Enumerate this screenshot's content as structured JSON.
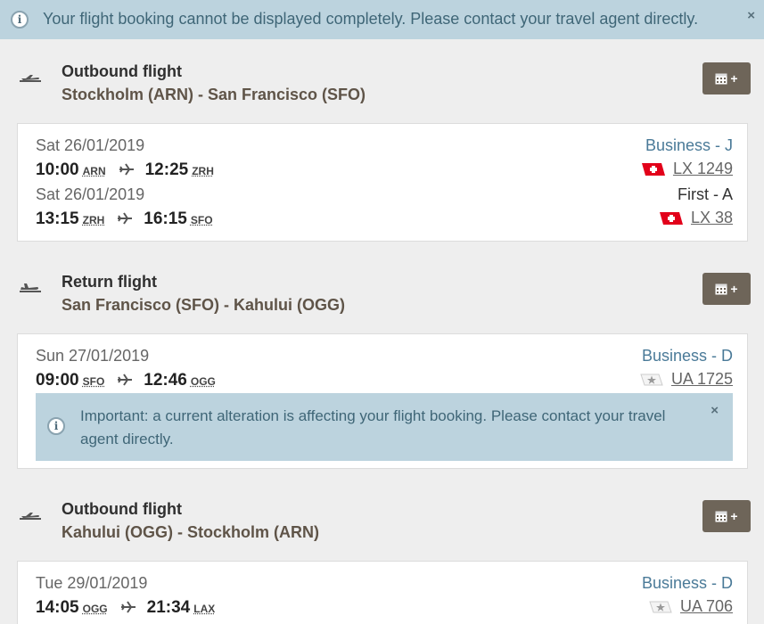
{
  "top_alert": {
    "text": "Your flight booking cannot be displayed completely. Please contact your travel agent directly.",
    "close": "×"
  },
  "sections": [
    {
      "title": "Outbound flight",
      "route": "Stockholm (ARN) - San Francisco (SFO)",
      "direction": "takeoff",
      "calendar_button": "+",
      "segments": [
        {
          "date": "Sat 26/01/2019",
          "dep_time": "10:00",
          "dep_airport": "ARN",
          "arr_time": "12:25",
          "arr_airport": "ZRH",
          "class": "Business - J",
          "class_color": "blue",
          "flight_no": "LX 1249",
          "airline": "swiss"
        },
        {
          "date": "Sat 26/01/2019",
          "dep_time": "13:15",
          "dep_airport": "ZRH",
          "arr_time": "16:15",
          "arr_airport": "SFO",
          "class": "First - A",
          "class_color": "dark",
          "flight_no": "LX 38",
          "airline": "swiss"
        }
      ]
    },
    {
      "title": "Return flight",
      "route": "San Francisco (SFO) - Kahului (OGG)",
      "direction": "landing",
      "calendar_button": "+",
      "segments": [
        {
          "date": "Sun 27/01/2019",
          "dep_time": "09:00",
          "dep_airport": "SFO",
          "arr_time": "12:46",
          "arr_airport": "OGG",
          "class": "Business - D",
          "class_color": "blue",
          "flight_no": "UA 1725",
          "airline": "star-alliance"
        }
      ],
      "alert": {
        "text": "Important: a current alteration is affecting your flight booking. Please contact your travel agent directly.",
        "close": "×"
      }
    },
    {
      "title": "Outbound flight",
      "route": "Kahului (OGG) - Stockholm (ARN)",
      "direction": "takeoff",
      "calendar_button": "+",
      "segments": [
        {
          "date": "Tue 29/01/2019",
          "dep_time": "14:05",
          "dep_airport": "OGG",
          "arr_time": "21:34",
          "arr_airport": "LAX",
          "class": "Business - D",
          "class_color": "blue",
          "flight_no": "UA 706",
          "airline": "star-alliance"
        }
      ]
    }
  ],
  "colors": {
    "page_bg": "#eeeeee",
    "alert_bg": "#bcd3de",
    "alert_text": "#3f6677",
    "button_bg": "#6e6559",
    "class_blue": "#4a7a98",
    "swiss_red": "#e2001a"
  },
  "icons": {
    "info": "info-icon",
    "close": "close-icon",
    "takeoff": "plane-takeoff-icon",
    "landing": "plane-landing-icon",
    "calendar": "calendar-add-icon",
    "arrow": "plane-arrow-icon"
  }
}
